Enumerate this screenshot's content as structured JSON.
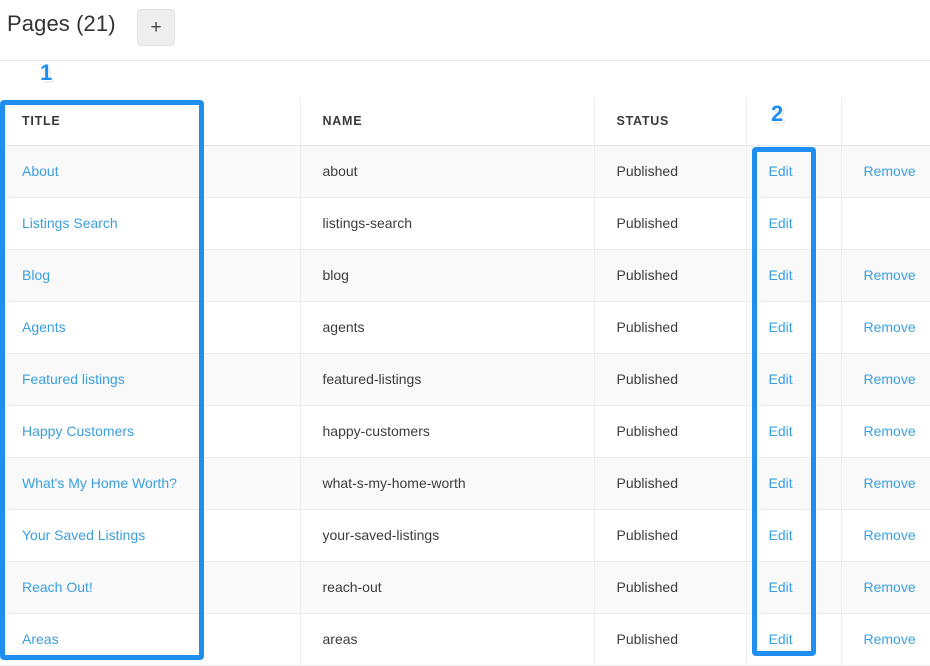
{
  "header": {
    "title": "Pages (21)",
    "add_button_label": "+",
    "add_button_icon": "plus-icon"
  },
  "table": {
    "columns": [
      "TITLE",
      "NAME",
      "STATUS",
      "",
      ""
    ],
    "actions": {
      "edit_label": "Edit",
      "remove_label": "Remove"
    },
    "rows": [
      {
        "title": "About",
        "name": "about",
        "status": "Published",
        "edit": "Edit",
        "remove": "Remove"
      },
      {
        "title": "Listings Search",
        "name": "listings-search",
        "status": "Published",
        "edit": "Edit",
        "remove": ""
      },
      {
        "title": "Blog",
        "name": "blog",
        "status": "Published",
        "edit": "Edit",
        "remove": "Remove"
      },
      {
        "title": "Agents",
        "name": "agents",
        "status": "Published",
        "edit": "Edit",
        "remove": "Remove"
      },
      {
        "title": "Featured listings",
        "name": "featured-listings",
        "status": "Published",
        "edit": "Edit",
        "remove": "Remove"
      },
      {
        "title": "Happy Customers",
        "name": "happy-customers",
        "status": "Published",
        "edit": "Edit",
        "remove": "Remove"
      },
      {
        "title": "What's My Home Worth?",
        "name": "what-s-my-home-worth",
        "status": "Published",
        "edit": "Edit",
        "remove": "Remove"
      },
      {
        "title": "Your Saved Listings",
        "name": "your-saved-listings",
        "status": "Published",
        "edit": "Edit",
        "remove": "Remove"
      },
      {
        "title": "Reach Out!",
        "name": "reach-out",
        "status": "Published",
        "edit": "Edit",
        "remove": "Remove"
      },
      {
        "title": "Areas",
        "name": "areas",
        "status": "Published",
        "edit": "Edit",
        "remove": "Remove"
      }
    ]
  },
  "annotations": {
    "marker_1": "1",
    "marker_2": "2",
    "highlight_color": "#1f8ef1"
  },
  "colors": {
    "link": "#3a9fdc",
    "accent": "#1f8ef1",
    "row_alt": "#f9f9f9",
    "text": "#3c3c3c"
  }
}
